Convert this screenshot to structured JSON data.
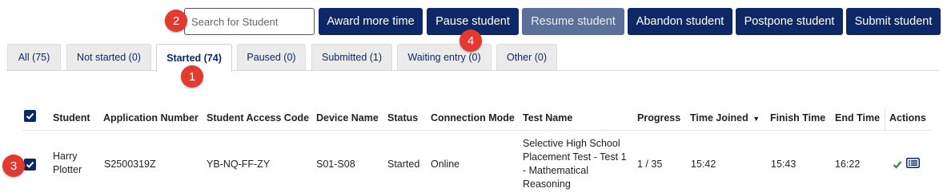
{
  "search": {
    "placeholder": "Search for Student",
    "value": ""
  },
  "toolbar": {
    "award_label": "Award more time",
    "pause_label": "Pause student",
    "resume_label": "Resume student",
    "abandon_label": "Abandon student",
    "postpone_label": "Postpone student",
    "submit_label": "Submit student"
  },
  "tabs": [
    {
      "label": "All (75)"
    },
    {
      "label": "Not started (0)"
    },
    {
      "label": "Started (74)",
      "active": true
    },
    {
      "label": "Paused (0)"
    },
    {
      "label": "Submitted (1)"
    },
    {
      "label": "Waiting entry (0)"
    },
    {
      "label": "Other (0)"
    }
  ],
  "table": {
    "headers": {
      "student": "Student",
      "application_number": "Application Number",
      "access_code": "Student Access Code",
      "device_name": "Device Name",
      "status": "Status",
      "connection_mode": "Connection Mode",
      "test_name": "Test Name",
      "progress": "Progress",
      "time_joined": "Time Joined",
      "finish_time": "Finish Time",
      "end_time": "End Time",
      "actions": "Actions"
    },
    "sort_indicator": "▼",
    "rows": [
      {
        "checked": true,
        "student": "Harry Plotter",
        "application_number": "S2500319Z",
        "access_code": "YB-NQ-FF-ZY",
        "device_name": "S01-S08",
        "status": "Started",
        "connection_mode": "Online",
        "test_name": "Selective High School Placement Test - Test 1 - Mathematical Reasoning",
        "progress": "1 / 35",
        "time_joined": "15:42",
        "finish_time": "15:43",
        "end_time": "16:22"
      }
    ]
  },
  "annotations": [
    "1",
    "2",
    "3",
    "4"
  ],
  "colors": {
    "primary": "#0d2866",
    "disabled": "#5b7099",
    "badge": "#e23a2e",
    "check_green": "#2e8b2e"
  }
}
